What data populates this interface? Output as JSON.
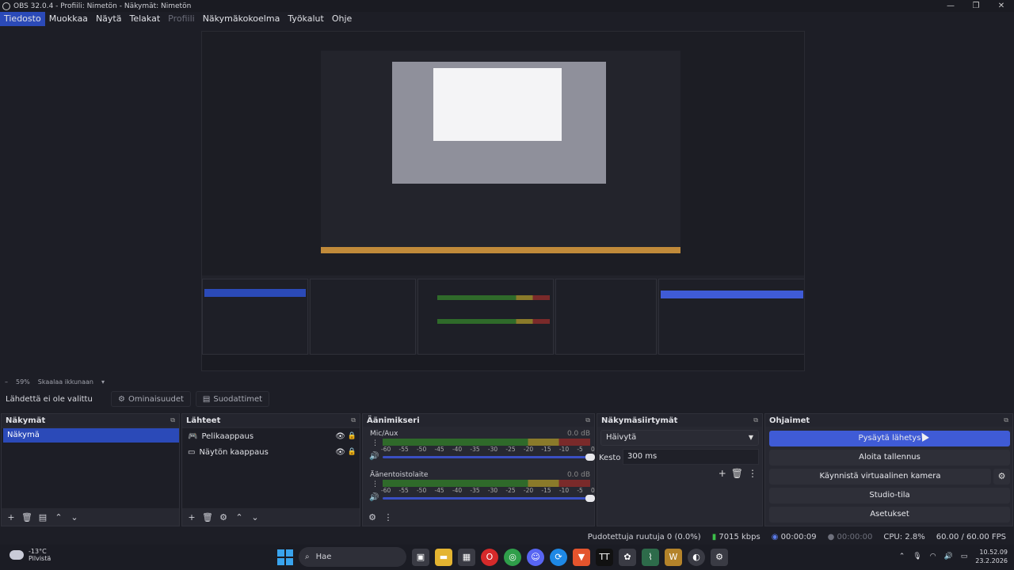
{
  "window": {
    "title": "OBS 32.0.4 - Profiili: Nimetön - Näkymät: Nimetön"
  },
  "menu": {
    "items": [
      {
        "label": "Tiedosto"
      },
      {
        "label": "Muokkaa"
      },
      {
        "label": "Näytä"
      },
      {
        "label": "Telakat"
      },
      {
        "label": "Profiili"
      },
      {
        "label": "Näkymäkokoelma"
      },
      {
        "label": "Työkalut"
      },
      {
        "label": "Ohje"
      }
    ]
  },
  "scale": {
    "zoom": "59%",
    "mode": "Skaalaa ikkunaan"
  },
  "properties_bar": {
    "no_source": "Lähdettä ei ole valittu",
    "properties": "Ominaisuudet",
    "filters": "Suodattimet"
  },
  "scenes": {
    "title": "Näkymät",
    "items": [
      {
        "label": "Näkymä"
      }
    ]
  },
  "sources": {
    "title": "Lähteet",
    "items": [
      {
        "label": "Pelikaappaus"
      },
      {
        "label": "Näytön kaappaus"
      }
    ]
  },
  "mixer": {
    "title": "Äänimikseri",
    "channels": [
      {
        "name": "Mic/Aux",
        "db": "0.0 dB"
      },
      {
        "name": "Äänentoistolaite",
        "db": "0.0 dB"
      }
    ],
    "ticks": [
      "-60",
      "-55",
      "-50",
      "-45",
      "-40",
      "-35",
      "-30",
      "-25",
      "-20",
      "-15",
      "-10",
      "-5",
      "0"
    ]
  },
  "transitions": {
    "title": "Näkymäsiirtymät",
    "selected": "Häivytä",
    "duration_label": "Kesto",
    "duration_value": "300 ms"
  },
  "controls": {
    "title": "Ohjaimet",
    "stop_stream": "Pysäytä lähetys",
    "start_record": "Aloita tallennus",
    "virtual_cam": "Käynnistä virtuaalinen kamera",
    "studio_mode": "Studio-tila",
    "settings": "Asetukset"
  },
  "status": {
    "dropped": "Pudotettuja ruutuja 0 (0.0%)",
    "bitrate": "7015 kbps",
    "stream_time": "00:00:09",
    "rec_time": "00:00:00",
    "cpu": "CPU: 2.8%",
    "fps": "60.00 / 60.00 FPS"
  },
  "taskbar": {
    "temp": "-13°C",
    "weather": "Pilvistä",
    "search": "Hae",
    "time": "10.52.09",
    "date": "23.2.2026"
  },
  "colors": {
    "accent": "#2b4ab8",
    "primary_button": "#3f5bd6",
    "background": "#1d1e26"
  }
}
